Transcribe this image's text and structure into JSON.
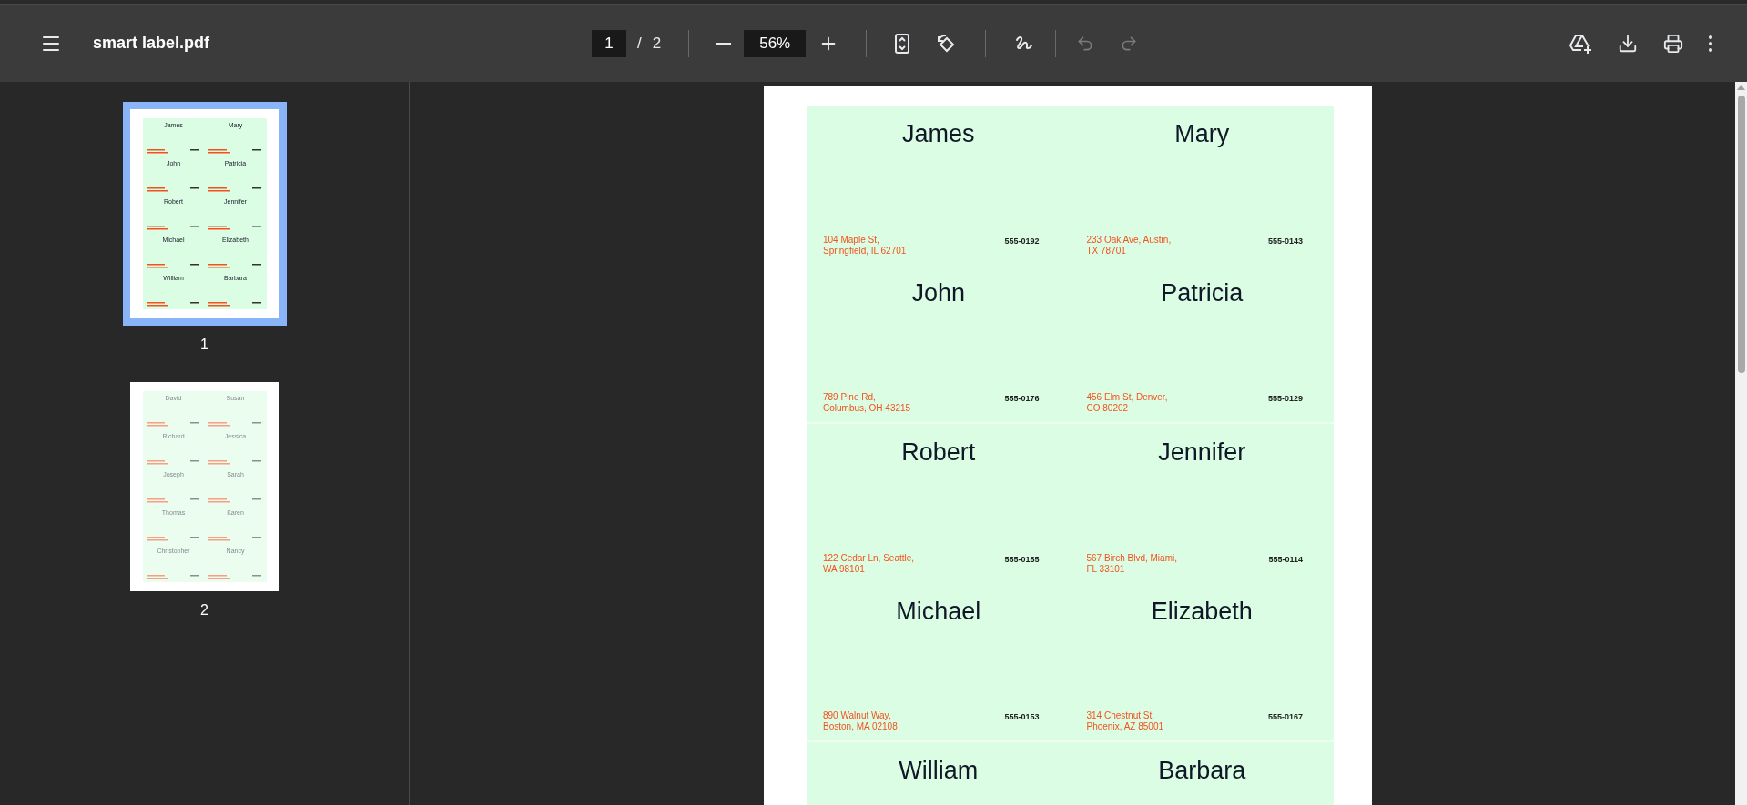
{
  "toolbar": {
    "title": "smart label.pdf",
    "page_input": "1",
    "page_separator": "/",
    "page_count": "2",
    "zoom": "56%",
    "undo_disabled": true,
    "redo_disabled": true
  },
  "thumbnails": [
    {
      "page_label": "1",
      "selected": true,
      "names": [
        "James",
        "Mary",
        "John",
        "Patricia",
        "Robert",
        "Jennifer",
        "Michael",
        "Elizabeth",
        "William",
        "Barbara"
      ]
    },
    {
      "page_label": "2",
      "selected": false,
      "names": [
        "David",
        "Susan",
        "Richard",
        "Jessica",
        "Joseph",
        "Sarah",
        "Thomas",
        "Karen",
        "Christopher",
        "Nancy"
      ]
    }
  ],
  "labels": [
    {
      "name": "James",
      "address": "104 Maple St,\nSpringfield, IL 62701",
      "phone": "555-0192"
    },
    {
      "name": "Mary",
      "address": "233 Oak Ave, Austin,\nTX 78701",
      "phone": "555-0143"
    },
    {
      "name": "John",
      "address": "789 Pine Rd,\nColumbus, OH 43215",
      "phone": "555-0176"
    },
    {
      "name": "Patricia",
      "address": "456 Elm St, Denver,\nCO 80202",
      "phone": "555-0129"
    },
    {
      "name": "Robert",
      "address": "122 Cedar Ln, Seattle,\nWA 98101",
      "phone": "555-0185"
    },
    {
      "name": "Jennifer",
      "address": "567 Birch Blvd, Miami,\nFL 33101",
      "phone": "555-0114"
    },
    {
      "name": "Michael",
      "address": "890 Walnut Way,\nBoston, MA 02108",
      "phone": "555-0153"
    },
    {
      "name": "Elizabeth",
      "address": "314 Chestnut St,\nPhoenix, AZ 85001",
      "phone": "555-0167"
    },
    {
      "name": "William"
    },
    {
      "name": "Barbara"
    }
  ]
}
